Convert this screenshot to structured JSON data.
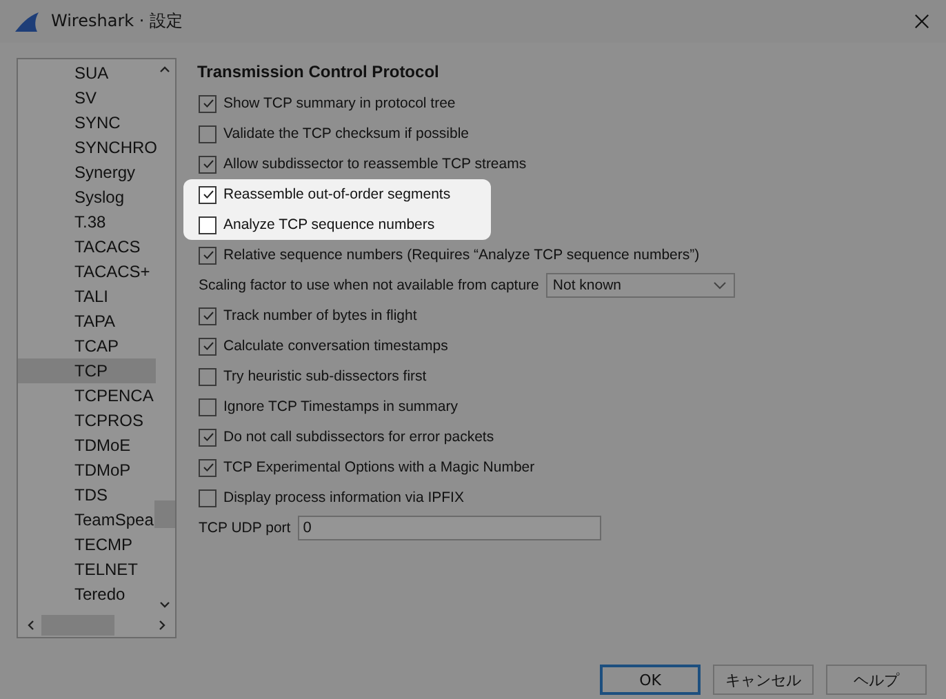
{
  "window": {
    "title": "Wireshark · 設定"
  },
  "sidebar": {
    "items": [
      {
        "label": "SUA",
        "selected": false
      },
      {
        "label": "SV",
        "selected": false
      },
      {
        "label": "SYNC",
        "selected": false
      },
      {
        "label": "SYNCHRO",
        "selected": false
      },
      {
        "label": "Synergy",
        "selected": false
      },
      {
        "label": "Syslog",
        "selected": false
      },
      {
        "label": "T.38",
        "selected": false
      },
      {
        "label": "TACACS",
        "selected": false
      },
      {
        "label": "TACACS+",
        "selected": false
      },
      {
        "label": "TALI",
        "selected": false
      },
      {
        "label": "TAPA",
        "selected": false
      },
      {
        "label": "TCAP",
        "selected": false
      },
      {
        "label": "TCP",
        "selected": true
      },
      {
        "label": "TCPENCA",
        "selected": false
      },
      {
        "label": "TCPROS",
        "selected": false
      },
      {
        "label": "TDMoE",
        "selected": false
      },
      {
        "label": "TDMoP",
        "selected": false
      },
      {
        "label": "TDS",
        "selected": false
      },
      {
        "label": "TeamSpea",
        "selected": false
      },
      {
        "label": "TECMP",
        "selected": false
      },
      {
        "label": "TELNET",
        "selected": false
      },
      {
        "label": "Teredo",
        "selected": false
      }
    ]
  },
  "panel": {
    "heading": "Transmission Control Protocol",
    "options": [
      {
        "kind": "checkbox",
        "label": "Show TCP summary in protocol tree",
        "checked": true,
        "highlighted": false
      },
      {
        "kind": "checkbox",
        "label": "Validate the TCP checksum if possible",
        "checked": false,
        "highlighted": false
      },
      {
        "kind": "checkbox",
        "label": "Allow subdissector to reassemble TCP streams",
        "checked": true,
        "highlighted": false
      },
      {
        "kind": "checkbox",
        "label": "Reassemble out-of-order segments",
        "checked": true,
        "highlighted": true
      },
      {
        "kind": "checkbox",
        "label": "Analyze TCP sequence numbers",
        "checked": false,
        "highlighted": true
      },
      {
        "kind": "checkbox",
        "label": "Relative sequence numbers (Requires “Analyze TCP sequence numbers”)",
        "checked": true,
        "highlighted": false
      },
      {
        "kind": "combo",
        "label": "Scaling factor to use when not available from capture",
        "value": "Not known"
      },
      {
        "kind": "checkbox",
        "label": "Track number of bytes in flight",
        "checked": true,
        "highlighted": false
      },
      {
        "kind": "checkbox",
        "label": "Calculate conversation timestamps",
        "checked": true,
        "highlighted": false
      },
      {
        "kind": "checkbox",
        "label": "Try heuristic sub-dissectors first",
        "checked": false,
        "highlighted": false
      },
      {
        "kind": "checkbox",
        "label": "Ignore TCP Timestamps in summary",
        "checked": false,
        "highlighted": false
      },
      {
        "kind": "checkbox",
        "label": "Do not call subdissectors for error packets",
        "checked": true,
        "highlighted": false
      },
      {
        "kind": "checkbox",
        "label": "TCP Experimental Options with a Magic Number",
        "checked": true,
        "highlighted": false
      },
      {
        "kind": "checkbox",
        "label": "Display process information via IPFIX",
        "checked": false,
        "highlighted": false
      },
      {
        "kind": "text",
        "label": "TCP UDP port",
        "value": "0"
      }
    ]
  },
  "buttons": [
    {
      "label": "OK",
      "default": true
    },
    {
      "label": "キャンセル",
      "default": false
    },
    {
      "label": "ヘルプ",
      "default": false
    }
  ]
}
